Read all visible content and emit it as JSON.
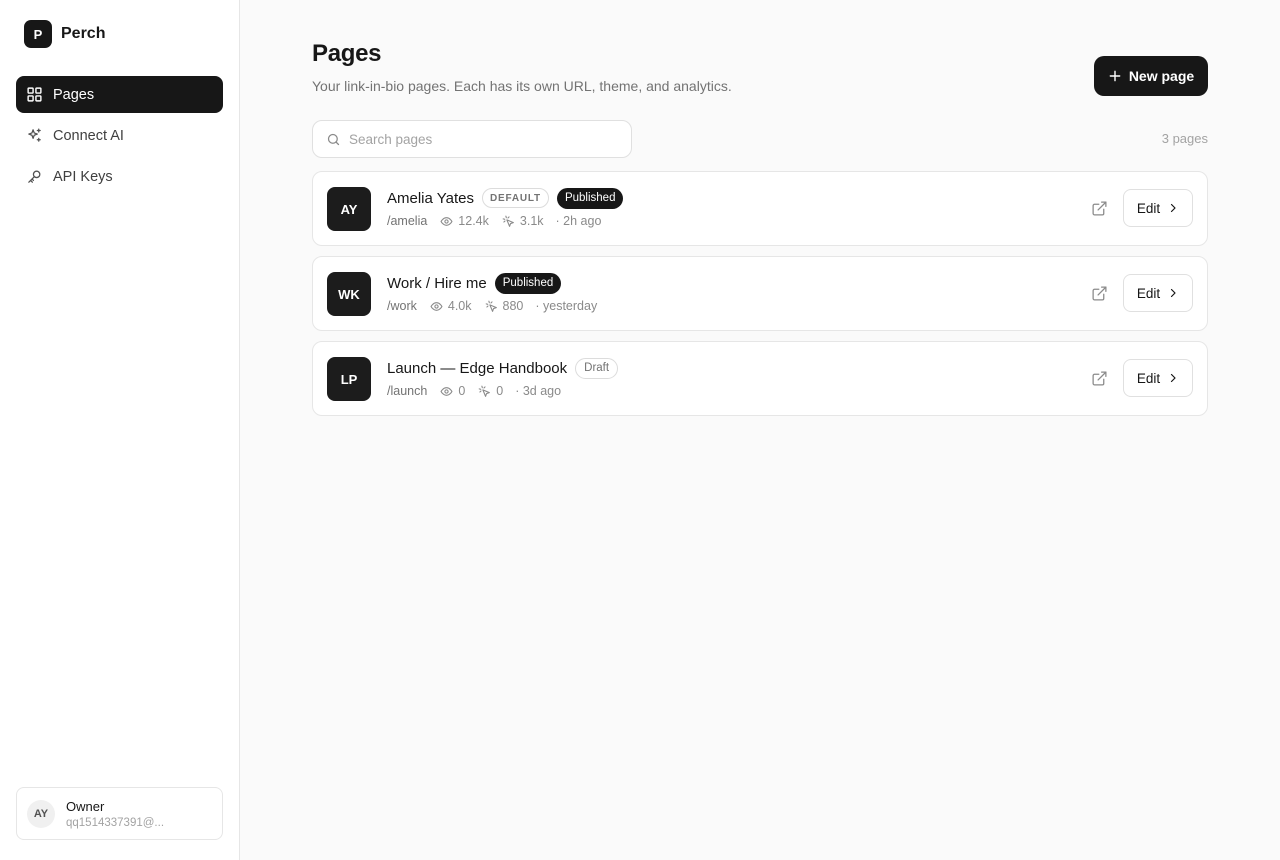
{
  "brand": {
    "logo_letter": "P",
    "name": "Perch"
  },
  "sidebar": {
    "items": [
      {
        "label": "Pages",
        "icon": "grid-icon",
        "active": true
      },
      {
        "label": "Connect AI",
        "icon": "sparkles-icon",
        "active": false
      },
      {
        "label": "API Keys",
        "icon": "key-icon",
        "active": false
      }
    ]
  },
  "user": {
    "initials": "AY",
    "role": "Owner",
    "email": "qq1514337391@..."
  },
  "header": {
    "title": "Pages",
    "subtitle": "Your link-in-bio pages. Each has its own URL, theme, and analytics.",
    "new_button_label": "New page"
  },
  "search": {
    "placeholder": "Search pages",
    "value": ""
  },
  "page_count": "3 pages",
  "pages": [
    {
      "initials": "AY",
      "title": "Amelia Yates",
      "default_badge": "DEFAULT",
      "status": "Published",
      "status_kind": "published",
      "slug": "/amelia",
      "views": "12.4k",
      "clicks": "3.1k",
      "updated": "· 2h ago",
      "edit_label": "Edit"
    },
    {
      "initials": "WK",
      "title": "Work / Hire me",
      "default_badge": "",
      "status": "Published",
      "status_kind": "published",
      "slug": "/work",
      "views": "4.0k",
      "clicks": "880",
      "updated": "· yesterday",
      "edit_label": "Edit"
    },
    {
      "initials": "LP",
      "title": "Launch — Edge Handbook",
      "default_badge": "",
      "status": "Draft",
      "status_kind": "draft",
      "slug": "/launch",
      "views": "0",
      "clicks": "0",
      "updated": "· 3d ago",
      "edit_label": "Edit"
    }
  ],
  "colors": {
    "accent": "#171717",
    "background": "#fafafa",
    "muted_text": "#737373",
    "border": "#e6e6e6"
  }
}
